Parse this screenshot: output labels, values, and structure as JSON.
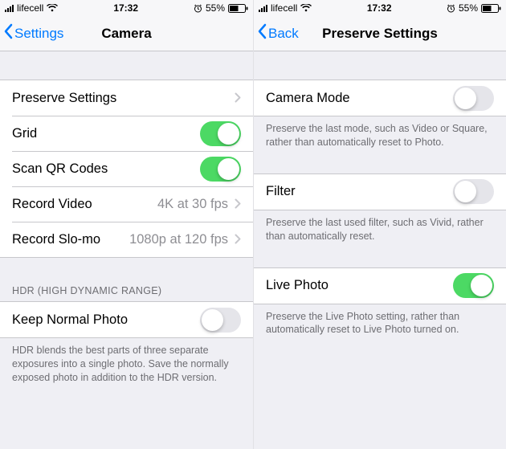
{
  "status": {
    "carrier": "lifecell",
    "time": "17:32",
    "battery_pct": "55%"
  },
  "left": {
    "back_label": "Settings",
    "title": "Camera",
    "rows": {
      "preserve": "Preserve Settings",
      "grid": "Grid",
      "qr": "Scan QR Codes",
      "video": "Record Video",
      "video_detail": "4K at 30 fps",
      "slomo": "Record Slo-mo",
      "slomo_detail": "1080p at 120 fps"
    },
    "hdr_header": "HDR (HIGH DYNAMIC RANGE)",
    "keep_normal": "Keep Normal Photo",
    "hdr_footer": "HDR blends the best parts of three separate exposures into a single photo. Save the normally exposed photo in addition to the HDR version."
  },
  "right": {
    "back_label": "Back",
    "title": "Preserve Settings",
    "camera_mode": "Camera Mode",
    "camera_mode_footer": "Preserve the last mode, such as Video or Square, rather than automatically reset to Photo.",
    "filter": "Filter",
    "filter_footer": "Preserve the last used filter, such as Vivid, rather than automatically reset.",
    "live_photo": "Live Photo",
    "live_photo_footer": "Preserve the Live Photo setting, rather than automatically reset to Live Photo turned on."
  }
}
